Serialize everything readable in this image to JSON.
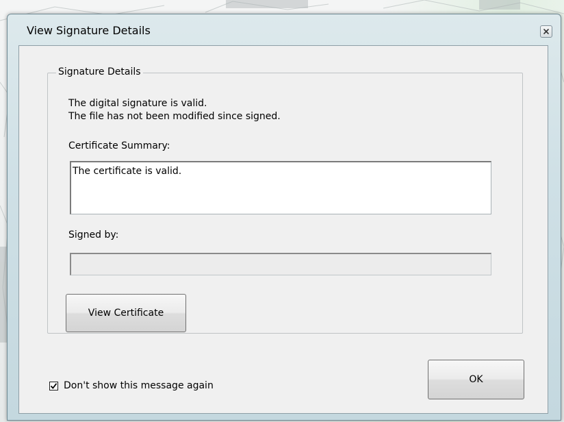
{
  "window": {
    "title": "View Signature Details"
  },
  "group": {
    "legend": "Signature Details",
    "status_lines": [
      "The digital signature is valid.",
      "The file has not been modified since signed."
    ]
  },
  "certificate_summary": {
    "label": "Certificate Summary:",
    "value": "The certificate is valid."
  },
  "signed_by": {
    "label": "Signed by:",
    "value": ""
  },
  "buttons": {
    "view_certificate": "View Certificate",
    "ok": "OK"
  },
  "dont_show": {
    "label": "Don't show this message again",
    "checked": true
  },
  "icons": {
    "close": "close-icon",
    "checkmark": "checkmark-icon"
  }
}
